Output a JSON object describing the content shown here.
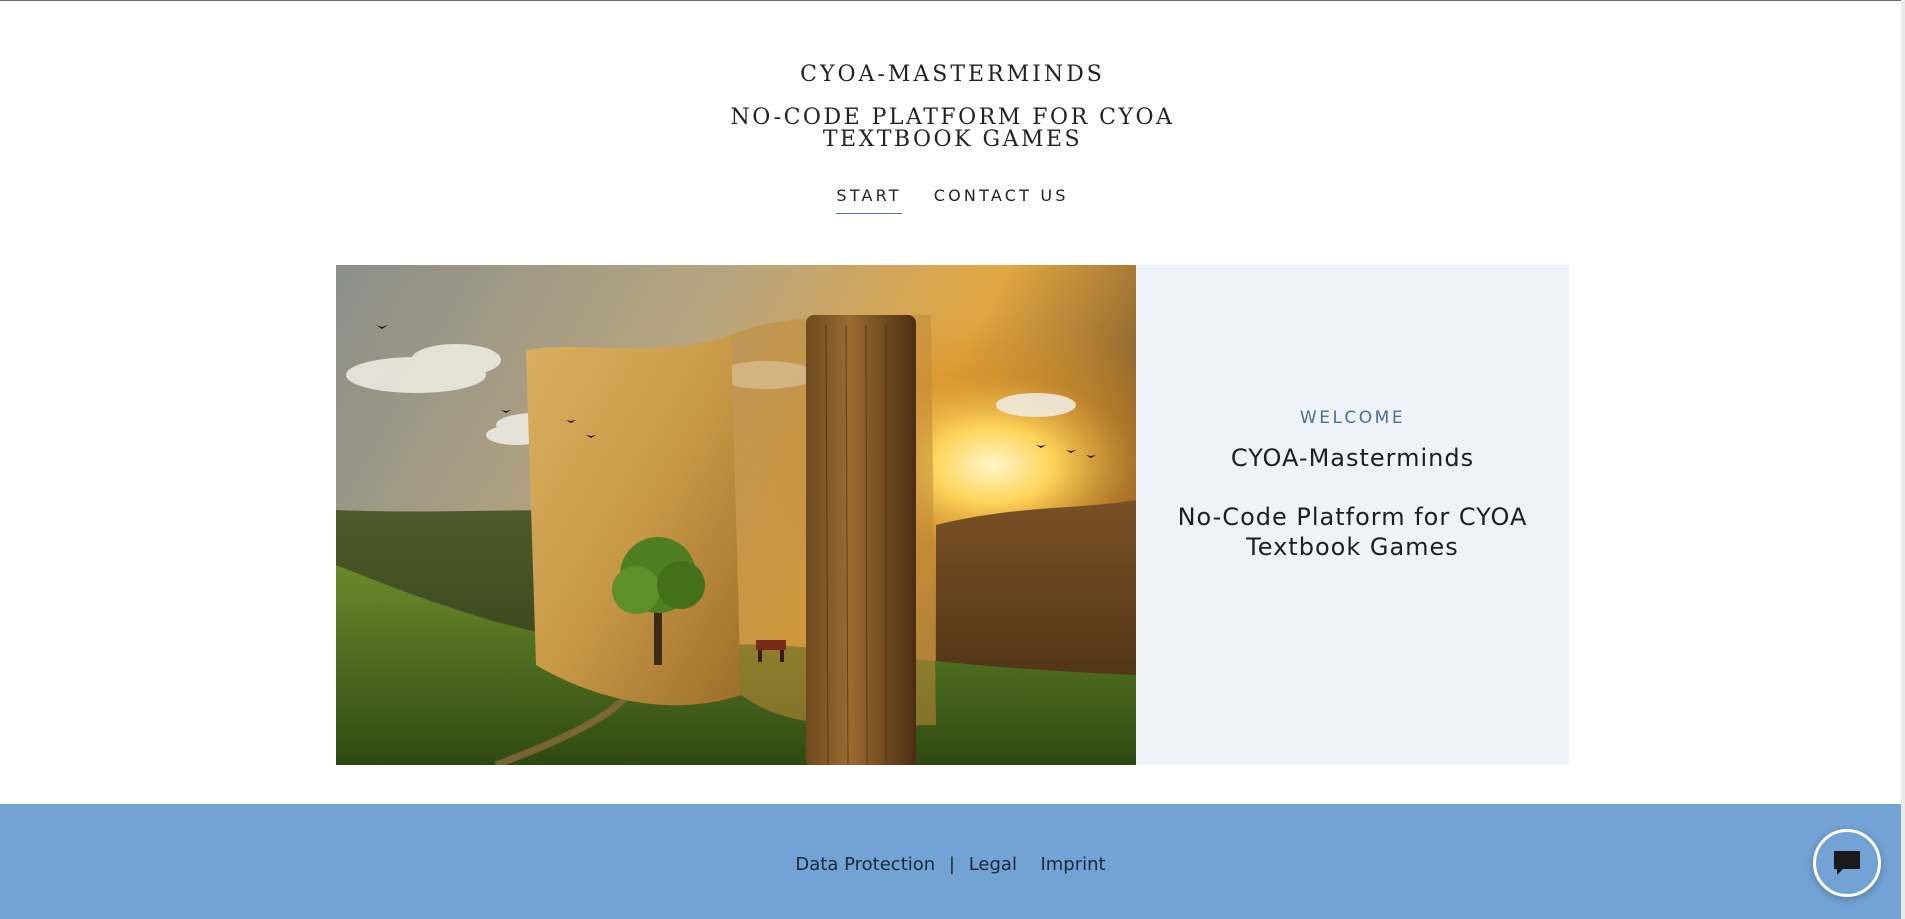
{
  "site": {
    "title": "CYOA-MASTERMINDS",
    "subtitle_line1": "NO-CODE PLATFORM FOR CYOA",
    "subtitle_line2": "TEXTBOOK GAMES"
  },
  "nav": {
    "items": [
      {
        "label": "START",
        "active": true
      },
      {
        "label": "CONTACT US",
        "active": false
      }
    ]
  },
  "hero": {
    "image_alt": "open book landscape with tree, path, birds and sunset",
    "panel": {
      "eyebrow": "WELCOME",
      "title": "CYOA-Masterminds",
      "sub_line1": "No-Code Platform for CYOA",
      "sub_line2": "Textbook Games"
    }
  },
  "footer": {
    "link_data_protection": "Data Protection",
    "separator": "|",
    "link_legal": "Legal",
    "link_imprint": "Imprint"
  },
  "colors": {
    "accent": "#4a76a8",
    "panel_bg": "#eef2f9",
    "footer_bg": "#73a3d4"
  },
  "icons": {
    "chat": "chat-bubble-icon"
  }
}
